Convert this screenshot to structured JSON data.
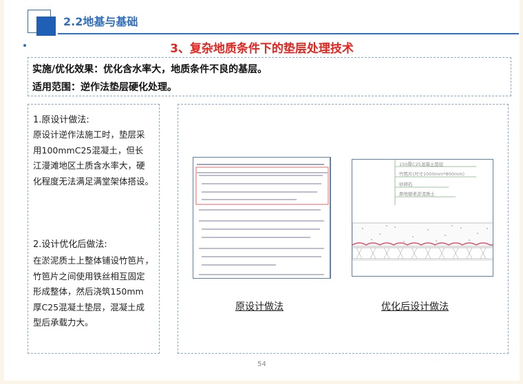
{
  "header": {
    "section_title": "2.2地基与基础"
  },
  "title": "3、复杂地质条件下的垫层处理技术",
  "effect": {
    "line1": "实施/优化效果：优化含水率大，地质条件不良的基层。",
    "line2": "适用范围：逆作法垫层硬化处理。"
  },
  "left_panel": {
    "heading1": "1.原设计做法:",
    "text1": "原设计逆作法施工时，垫层采\n用100mmC25混凝土，但长\n江漫滩地区土质含水率大，硬\n化程度无法满足满堂架体搭设。",
    "heading2": "2.设计优化后做法:",
    "text2": "在淤泥质土上整体铺设竹笆片，\n竹笆片之间使用铁丝相互固定\n形成整体，然后浇筑150mm\n厚C25混凝土垫层，混凝土成\n型后承载力大。"
  },
  "images": {
    "original_caption": "原设计做法",
    "optimized_caption": "优化后设计做法",
    "drawing_labels": [
      "150厚C25混凝土垫层",
      "竹笆片(尺寸1000mm*800mm)",
      "砂卵石",
      "原地貌老淤泥质土"
    ]
  },
  "page_number": "54"
}
